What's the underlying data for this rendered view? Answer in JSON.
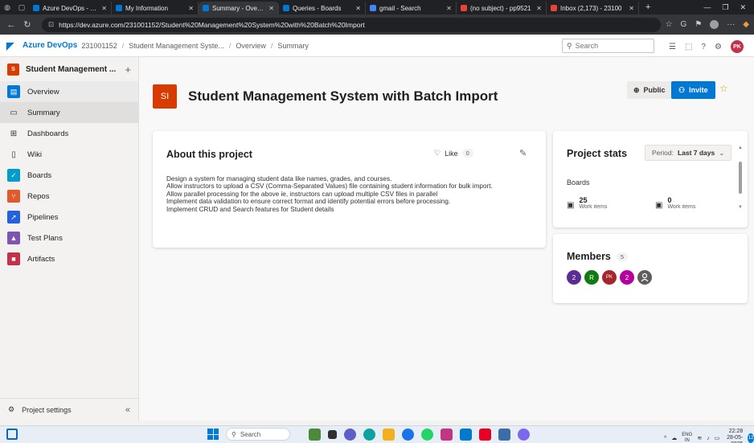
{
  "browser": {
    "tabs": [
      {
        "label": "Azure DevOps - Micr",
        "active": false,
        "favicon_color": "#0078d4"
      },
      {
        "label": "My Information",
        "active": false,
        "favicon_color": "#0078d4"
      },
      {
        "label": "Summary - Overview",
        "active": true,
        "favicon_color": "#0078d4"
      },
      {
        "label": "Queries - Boards",
        "active": false,
        "favicon_color": "#0078d4"
      },
      {
        "label": "gmail - Search",
        "active": false,
        "favicon_color": "#4285f4"
      },
      {
        "label": "(no subject) - pp9521",
        "active": false,
        "favicon_color": "#ea4335"
      },
      {
        "label": "Inbox (2,173) - 23100",
        "active": false,
        "favicon_color": "#ea4335"
      }
    ],
    "url": "https://dev.azure.com/231001152/Student%20Management%20System%20with%20Batch%20Import"
  },
  "topbar": {
    "brand": "Azure DevOps",
    "org": "231001152",
    "breadcrumbs": [
      "Student Management Syste...",
      "Overview",
      "Summary"
    ],
    "search_placeholder": "Search",
    "user_initials": "PK"
  },
  "sidebar": {
    "project_badge": "S",
    "project_name": "Student Management ...",
    "items": [
      {
        "label": "Overview",
        "icon": "overview-icon"
      },
      {
        "label": "Summary",
        "icon": "summary-icon"
      },
      {
        "label": "Dashboards",
        "icon": "dashboards-icon"
      },
      {
        "label": "Wiki",
        "icon": "wiki-icon"
      },
      {
        "label": "Boards",
        "icon": "boards-icon"
      },
      {
        "label": "Repos",
        "icon": "repos-icon"
      },
      {
        "label": "Pipelines",
        "icon": "pipelines-icon"
      },
      {
        "label": "Test Plans",
        "icon": "test-plans-icon"
      },
      {
        "label": "Artifacts",
        "icon": "artifacts-icon"
      }
    ],
    "settings_label": "Project settings"
  },
  "project": {
    "badge": "SI",
    "title": "Student Management System with Batch Import",
    "public_label": "Public",
    "invite_label": "Invite"
  },
  "about": {
    "title": "About this project",
    "like_label": "Like",
    "like_count": "0",
    "description": [
      "Design a system for managing student data like names, grades, and courses.",
      "Allow instructors to upload a CSV (Comma-Separated Values) file containing student information for bulk import.",
      "Allow parallel processing for the above ie, instructors can upload multiple CSV files in parallel",
      "Implement data validation to ensure correct format and identify potential errors before processing.",
      "Implement CRUD and Search features for Student details"
    ]
  },
  "stats": {
    "title": "Project stats",
    "period_prefix": "Period:",
    "period_value": "Last 7 days",
    "section": "Boards",
    "items": [
      {
        "value": "25",
        "label": "Work items created"
      },
      {
        "value": "0",
        "label": "Work items completed"
      }
    ]
  },
  "members": {
    "title": "Members",
    "count": "5",
    "avatars": [
      {
        "text": "2",
        "color": "#5c2d91"
      },
      {
        "text": "R",
        "color": "#107c10"
      },
      {
        "text": "PK",
        "color": "#a4262c"
      },
      {
        "text": "2",
        "color": "#b4009e"
      },
      {
        "text": "",
        "color": "#605e5c"
      }
    ]
  },
  "taskbar": {
    "search_label": "Search",
    "lang_top": "ENG",
    "lang_bottom": "IN",
    "time": "22:28",
    "date": "28-05-2025"
  }
}
